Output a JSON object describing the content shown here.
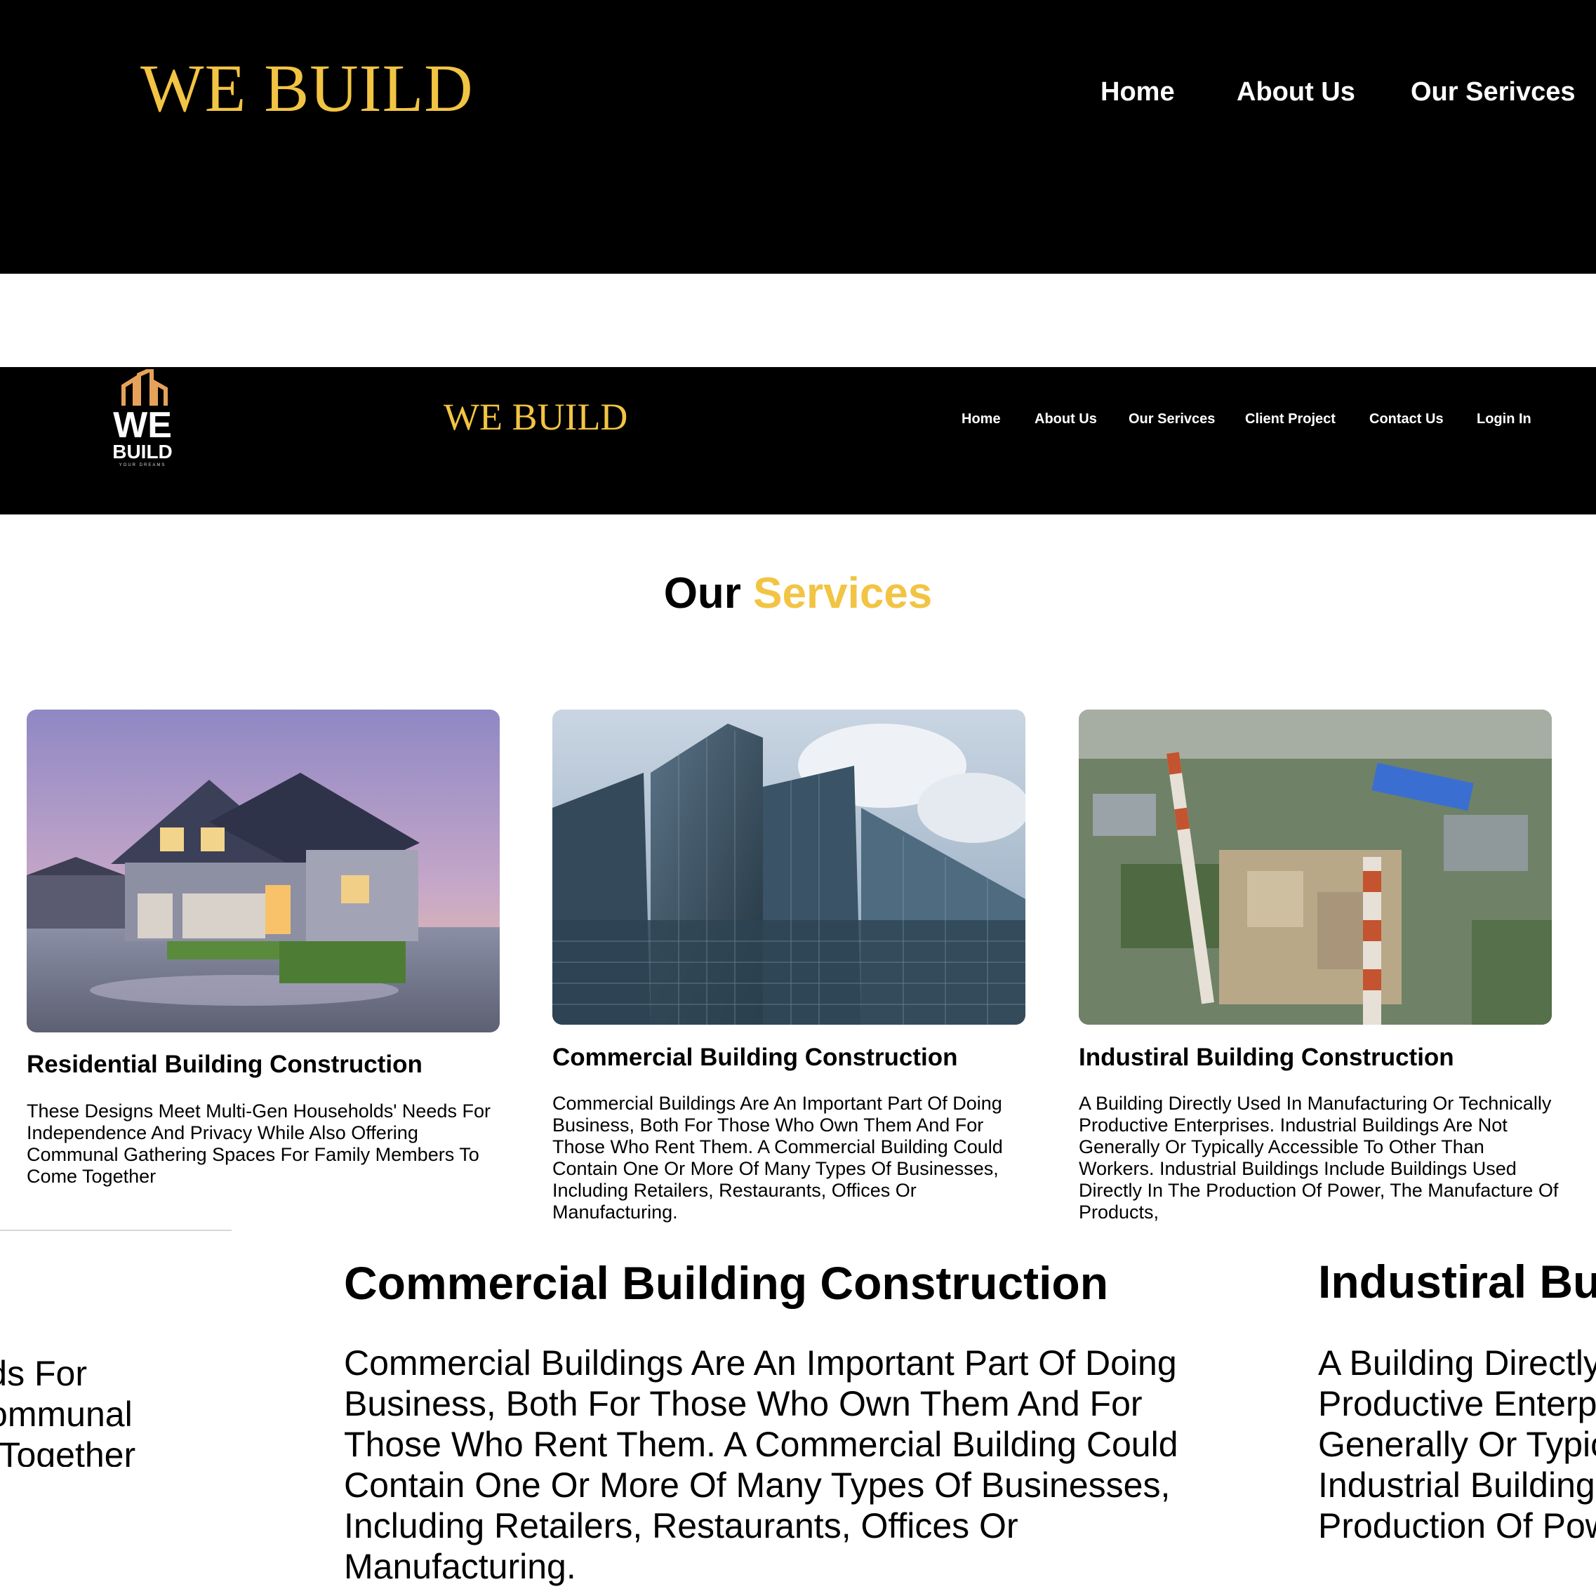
{
  "top_header": {
    "logo": "WE BUILD",
    "nav": [
      "Home",
      "About Us",
      "Our Serivces"
    ]
  },
  "navbar": {
    "brand": {
      "we": "WE",
      "build": "BUILD",
      "tagline": "YOUR DREAMS"
    },
    "title": "WE BUILD",
    "links": [
      "Home",
      "About Us",
      "Our Serivces",
      "Client Project",
      "Contact Us",
      "Login In"
    ]
  },
  "services": {
    "heading_main": "Our",
    "heading_accent": "Services",
    "cards": [
      {
        "title": "Residential Building Construction",
        "description": "These Designs Meet Multi-Gen Households' Needs For Independence And Privacy While Also Offering Communal Gathering Spaces For Family Members To Come Together",
        "image": "house-photo"
      },
      {
        "title": "Commercial Building Construction",
        "description": "Commercial Buildings Are An Important Part Of Doing Business, Both For Those Who Own Them And For Those Who Rent Them. A Commercial Building Could Contain One Or More Of Many Types Of Businesses, Including Retailers, Restaurants, Offices Or Manufacturing.",
        "image": "skyscraper-photo"
      },
      {
        "title": "Industiral Building Construction",
        "description": "A Building Directly Used In Manufacturing Or Technically Productive Enterprises. Industrial Buildings Are Not Generally Or Typically Accessible To Other Than Workers. Industrial Buildings Include Buildings Used Directly In The Production Of Power, The Manufacture Of Products,",
        "image": "factory-photo"
      }
    ]
  },
  "colors": {
    "accent": "#f2c443",
    "dark": "#000000",
    "background": "#ffffff"
  }
}
